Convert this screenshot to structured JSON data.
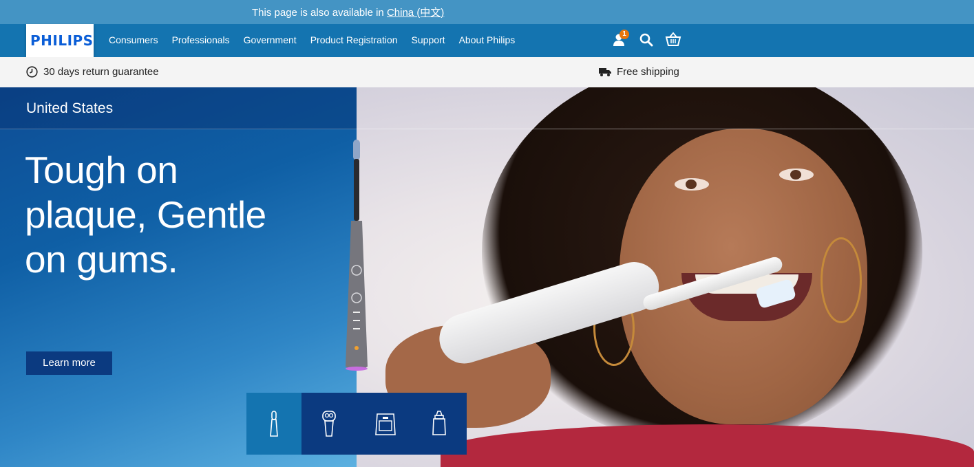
{
  "notice": {
    "prefix": "This page is also available in",
    "link_label": "China (中文)"
  },
  "brand": {
    "logo_text": "PHILIPS",
    "brand_color": "#0b5ed7"
  },
  "nav": {
    "links": [
      "Consumers",
      "Professionals",
      "Government",
      "Product Registration",
      "Support",
      "About Philips"
    ],
    "cart_badge": "1",
    "icons": [
      "account-icon",
      "search-icon",
      "basket-icon"
    ]
  },
  "promo": {
    "left": "30 days return guarantee",
    "right": "Free shipping"
  },
  "hero": {
    "region": "United States",
    "headline": "Tough on plaque, Gentle on gums.",
    "cta": "Learn more"
  },
  "categories": [
    {
      "name": "toothbrush-icon",
      "active": true
    },
    {
      "name": "shaver-icon",
      "active": false
    },
    {
      "name": "airfryer-icon",
      "active": false
    },
    {
      "name": "baby-bottle-icon",
      "active": false
    }
  ],
  "colors": {
    "nav": "#1474b0",
    "notice": "#4494c4",
    "cta": "#0b3a80",
    "badge": "#e8760a"
  }
}
